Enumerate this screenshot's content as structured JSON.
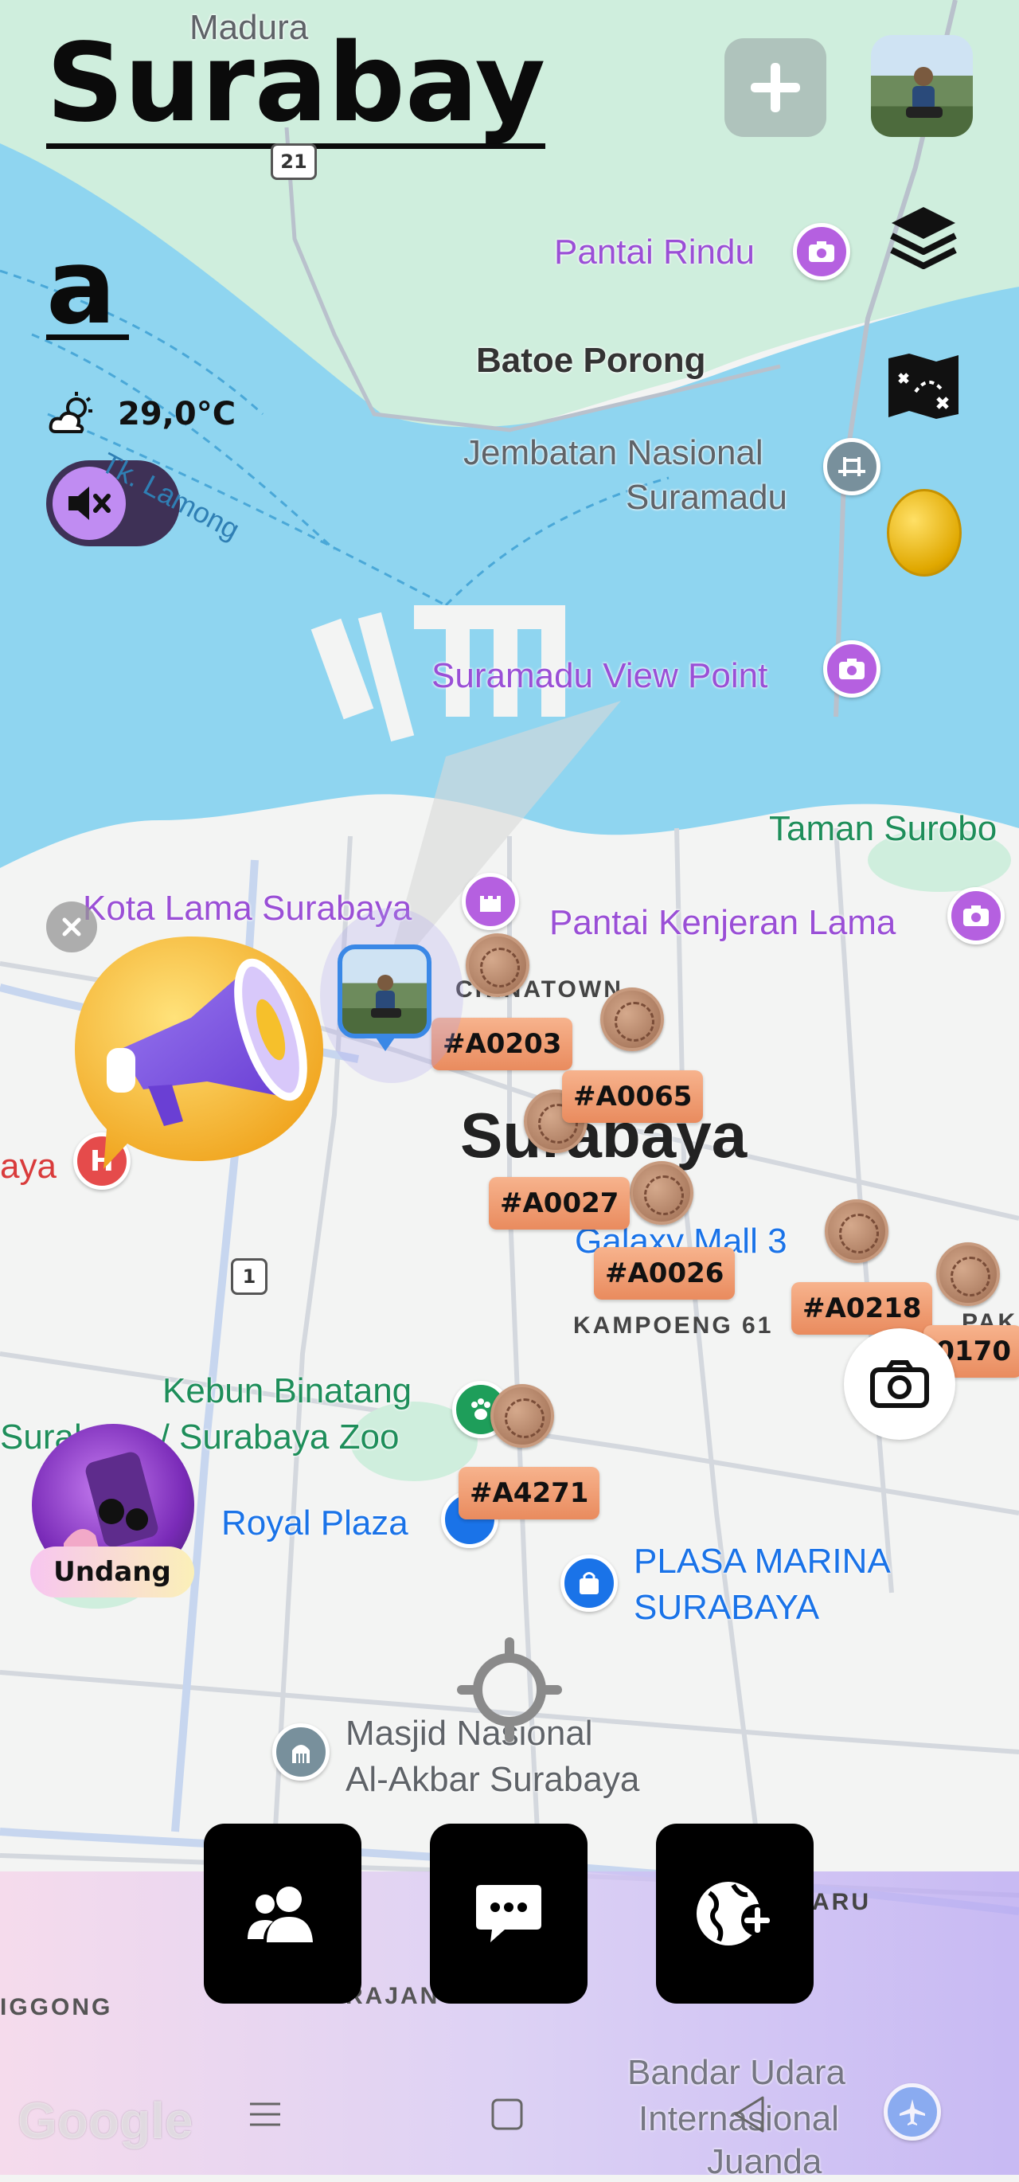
{
  "header": {
    "title_line1": "Surabay",
    "title_line2": "a",
    "temperature": "29,0°C",
    "weather_icon": "partly-cloudy-icon"
  },
  "map_labels": {
    "madura": "Madura",
    "road_21": "21",
    "road_1": "1",
    "pantai_rindu": "Pantai Rindu",
    "batoe_porong": "Batoe Porong",
    "jembatan_line1": "Jembatan Nasional",
    "jembatan_line2": "Suramadu",
    "tk_lamong": "Tk. Lamong",
    "suramadu_view": "Suramadu View Point",
    "taman": "Taman Surobo",
    "kota_lama": "Kota Lama Surabaya",
    "pantai_kenjeran": "Pantai Kenjeran Lama",
    "chinatown": "CHINATOWN",
    "city": "Surabaya",
    "galaxy_mall": "Galaxy Mall 3",
    "kampoeng": "KAMPOENG 61",
    "pak": "PAK",
    "aya": "aya",
    "kebun_line1": "Kebun Binatang",
    "kebun_line2": "Surabaya / Surabaya Zoo",
    "royal_plaza": "Royal Plaza",
    "plasa_marina_line1": "PLASA MARINA",
    "plasa_marina_line2": "SURABAYA",
    "masjid_line1": "Masjid Nasional",
    "masjid_line2": "Al-Akbar Surabaya",
    "aru": "ARU",
    "iggong": "IGGONG",
    "rajan": "RAJAN",
    "bandara_line1": "Bandar Udara",
    "bandara_line2": "Internasional",
    "bandara_line3": "Juanda",
    "google": "Google"
  },
  "tags": {
    "a0203": "#A0203",
    "a0065": "#A0065",
    "a0027": "#A0027",
    "a0026": "#A0026",
    "a0218": "#A0218",
    "a0170": "#A0170",
    "a4271": "#A4271"
  },
  "invite_label": "Undang",
  "colors": {
    "water": "#8fd5f0",
    "land": "#f3f4f3",
    "park": "#cfeedd",
    "purple_accent": "#9a4fd6",
    "tag": "#eea078",
    "sound_toggle": "#3e3156"
  },
  "icons": {
    "add": "plus-icon",
    "layers": "layers-icon",
    "treasure_map": "treasure-map-icon",
    "coin": "coin-icon",
    "mute": "mute-icon",
    "megaphone": "megaphone-icon",
    "camera": "camera-icon",
    "locate": "crosshair-icon",
    "friends": "people-icon",
    "chat": "chat-icon",
    "add_world": "globe-plus-icon"
  }
}
